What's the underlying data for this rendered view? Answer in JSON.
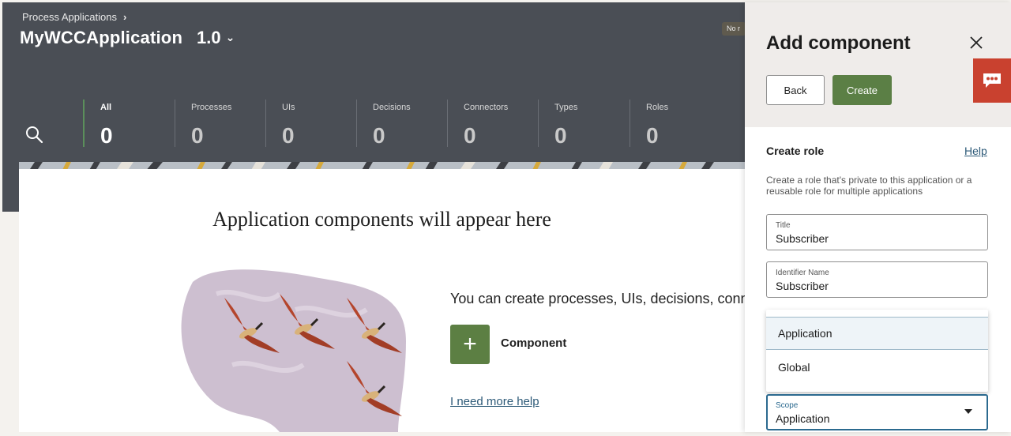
{
  "header": {
    "breadcrumb": "Process Applications",
    "app_name": "MyWCCApplication",
    "version": "1.0",
    "status_pill": "No r"
  },
  "stats": [
    {
      "label": "All",
      "value": "0"
    },
    {
      "label": "Processes",
      "value": "0"
    },
    {
      "label": "UIs",
      "value": "0"
    },
    {
      "label": "Decisions",
      "value": "0"
    },
    {
      "label": "Connectors",
      "value": "0"
    },
    {
      "label": "Types",
      "value": "0"
    },
    {
      "label": "Roles",
      "value": "0"
    }
  ],
  "main": {
    "title": "Application components will appear here",
    "description": "You can create processes, UIs, decisions, conne",
    "add_label": "Component",
    "help_link": "I need more help"
  },
  "panel": {
    "title": "Add component",
    "back_label": "Back",
    "create_label": "Create",
    "section_title": "Create role",
    "help_label": "Help",
    "section_desc": "Create a role that's private to this application or a reusable role for multiple applications",
    "title_field": {
      "label": "Title",
      "value": "Subscriber"
    },
    "identifier_field": {
      "label": "Identifier Name",
      "value": "Subscriber"
    },
    "scope_options": [
      "Application",
      "Global"
    ],
    "scope_field": {
      "label": "Scope",
      "value": "Application"
    }
  },
  "colors": {
    "header_bg": "#4a4e55",
    "accent_green": "#5b7f45",
    "feedback_red": "#c9412f",
    "link_blue": "#2d5a78"
  }
}
